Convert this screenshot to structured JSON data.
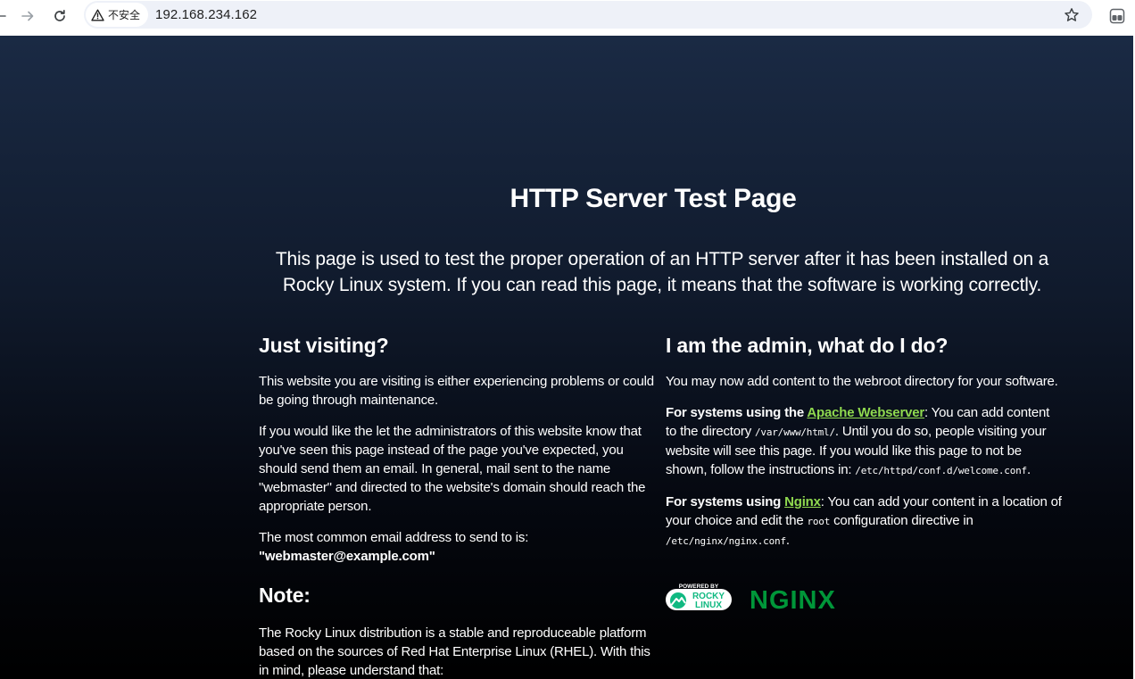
{
  "browser": {
    "security_label": "不安全",
    "url": "192.168.234.162"
  },
  "page": {
    "title": "HTTP Server Test Page",
    "lead": "This page is used to test the proper operation of an HTTP server after it has been installed on a Rocky Linux system. If you can read this page, it means that the software is working correctly.",
    "left": {
      "heading": "Just visiting?",
      "p1": "This website you are visiting is either experiencing problems or could be going through maintenance.",
      "p2": "If you would like the let the administrators of this website know that you've seen this page instead of the page you've expected, you should send them an email. In general, mail sent to the name \"webmaster\" and directed to the website's domain should reach the appropriate person.",
      "p3_text": "The most common email address to send to is:",
      "p3_email": "\"webmaster@example.com\"",
      "note_heading": "Note:",
      "note_p": "The Rocky Linux distribution is a stable and reproduceable platform based on the sources of Red Hat Enterprise Linux (RHEL). With this in mind, please understand that:"
    },
    "right": {
      "heading": "I am the admin, what do I do?",
      "p1": "You may now add content to the webroot directory for your software.",
      "apache": {
        "prefix": "For systems using the ",
        "link": "Apache Webserver",
        "text1": ": You can add content to the directory ",
        "code1": "/var/www/html/",
        "text2": ". Until you do so, people visiting your website will see this page. If you would like this page to not be shown, follow the instructions in: ",
        "code2": "/etc/httpd/conf.d/welcome.conf",
        "text3": "."
      },
      "nginx": {
        "prefix": "For systems using ",
        "link": "Nginx",
        "text1": ": You can add your content in a location of your choice and edit the ",
        "code1": "root",
        "text2": " configuration directive in ",
        "code2": "/etc/nginx/nginx.conf",
        "text3": "."
      }
    },
    "logos": {
      "rocky_small": "POWERED BY",
      "rocky_line1": "ROCKY",
      "rocky_line2": "LINUX",
      "nginx": "NGINX"
    },
    "colors": {
      "link": "#8fd94f",
      "nginx_logo": "#009639",
      "rocky_logo": "#10b981"
    }
  }
}
